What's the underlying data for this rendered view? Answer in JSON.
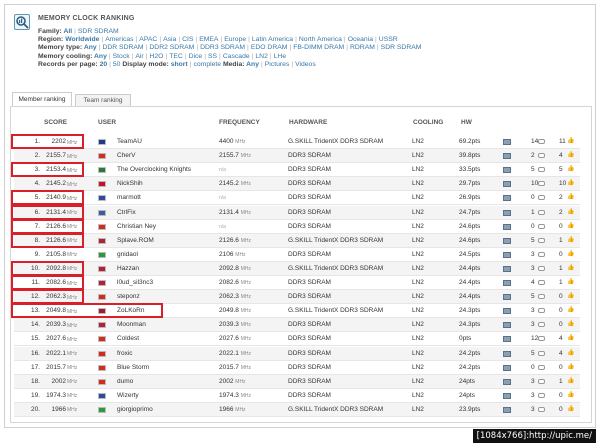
{
  "page_title": "MEMORY CLOCK RANKING",
  "filters": [
    {
      "label": "Family:",
      "options": [
        "All",
        "SDR SDRAM"
      ],
      "selected": "All"
    },
    {
      "label": "Region:",
      "options": [
        "Worldwide",
        "Americas",
        "APAC",
        "Asia",
        "CIS",
        "EMEA",
        "Europe",
        "Latin America",
        "North America",
        "Oceania",
        "USSR"
      ],
      "selected": "Worldwide"
    },
    {
      "label": "Memory type:",
      "options": [
        "Any",
        "DDR SDRAM",
        "DDR2 SDRAM",
        "DDR3 SDRAM",
        "EDO DRAM",
        "FB-DIMM DRAM",
        "RDRAM",
        "SDR SDRAM"
      ],
      "selected": "Any"
    },
    {
      "label": "Memory cooling:",
      "options": [
        "Any",
        "Stock",
        "Air",
        "H2O",
        "TEC",
        "Dice",
        "SS",
        "Cascade",
        "LN2",
        "LHe"
      ],
      "selected": "Any"
    },
    {
      "label": "Records per page:",
      "options": [
        "20",
        "50"
      ],
      "selected": "20",
      "extra_label": "Display mode:",
      "extra_options": [
        "short",
        "complete"
      ],
      "extra_selected": "short",
      "extra2_label": "Media:",
      "extra2_options": [
        "Any",
        "Pictures",
        "Videos"
      ],
      "extra2_selected": "Any"
    }
  ],
  "tabs": [
    {
      "label": "Member ranking",
      "active": true
    },
    {
      "label": "Team ranking",
      "active": false
    }
  ],
  "columns": {
    "score": "SCORE",
    "user": "USER",
    "frequency": "FREQUENCY",
    "hardware": "HARDWARE",
    "cooling": "COOLING",
    "hw": "HW"
  },
  "mhz_unit": "MHz",
  "na_text": "n/a",
  "rows": [
    {
      "rank": "1.",
      "score": "2202",
      "user": "TeamAU",
      "flag": "#1a3b8c",
      "freq": "4400",
      "freq_unit": "MHz",
      "hardware": "G.SKILL TridentX DDR3 SDRAM",
      "cooling": "LN2",
      "pts": "69.2pts",
      "comments": "14",
      "likes": "11"
    },
    {
      "rank": "2.",
      "score": "2155.7",
      "user": "CherV",
      "flag": "#d52b1e",
      "freq": "2155.7",
      "freq_unit": "MHz",
      "hardware": "DDR3 SDRAM",
      "cooling": "LN2",
      "pts": "39.8pts",
      "comments": "2",
      "likes": "4"
    },
    {
      "rank": "3.",
      "score": "2153.4",
      "user": "The Overclocking Knights",
      "flag": "#2b7a3a",
      "freq": "",
      "freq_unit": "",
      "hardware": "DDR3 SDRAM",
      "cooling": "LN2",
      "pts": "33.5pts",
      "comments": "5",
      "likes": "5"
    },
    {
      "rank": "4.",
      "score": "2145.2",
      "user": "NickShih",
      "flag": "#c8102e",
      "freq": "2145.2",
      "freq_unit": "MHz",
      "hardware": "DDR3 SDRAM",
      "cooling": "LN2",
      "pts": "29.7pts",
      "comments": "10",
      "likes": "10"
    },
    {
      "rank": "5.",
      "score": "2140.9",
      "user": "marmott",
      "flag": "#2b4aa0",
      "freq": "",
      "freq_unit": "",
      "hardware": "DDR3 SDRAM",
      "cooling": "LN2",
      "pts": "26.9pts",
      "comments": "0",
      "likes": "2"
    },
    {
      "rank": "6.",
      "score": "2131.4",
      "user": "CtrlFix",
      "flag": "#3b5aa8",
      "freq": "2131.4",
      "freq_unit": "MHz",
      "hardware": "DDR3 SDRAM",
      "cooling": "LN2",
      "pts": "24.7pts",
      "comments": "1",
      "likes": "2"
    },
    {
      "rank": "7.",
      "score": "2126.6",
      "user": "Christian Ney",
      "flag": "#d52b1e",
      "freq": "",
      "freq_unit": "",
      "hardware": "DDR3 SDRAM",
      "cooling": "LN2",
      "pts": "24.6pts",
      "comments": "0",
      "likes": "0"
    },
    {
      "rank": "8.",
      "score": "2126.6",
      "user": "Splave.ROM",
      "flag": "#b22234",
      "freq": "2126.6",
      "freq_unit": "MHz",
      "hardware": "G.SKILL TridentX DDR3 SDRAM",
      "cooling": "LN2",
      "pts": "24.6pts",
      "comments": "5",
      "likes": "1"
    },
    {
      "rank": "9.",
      "score": "2105.8",
      "user": "gnidaol",
      "flag": "#2a9a3a",
      "freq": "2106",
      "freq_unit": "MHz",
      "hardware": "DDR3 SDRAM",
      "cooling": "LN2",
      "pts": "24.5pts",
      "comments": "3",
      "likes": "0"
    },
    {
      "rank": "10.",
      "score": "2092.8",
      "user": "Hazzan",
      "flag": "#b22234",
      "freq": "2092.8",
      "freq_unit": "MHz",
      "hardware": "G.SKILL TridentX DDR3 SDRAM",
      "cooling": "LN2",
      "pts": "24.4pts",
      "comments": "3",
      "likes": "1"
    },
    {
      "rank": "11.",
      "score": "2082.6",
      "user": "l0ud_sil3nc3",
      "flag": "#b22234",
      "freq": "2082.6",
      "freq_unit": "MHz",
      "hardware": "DDR3 SDRAM",
      "cooling": "LN2",
      "pts": "24.4pts",
      "comments": "4",
      "likes": "1"
    },
    {
      "rank": "12.",
      "score": "2062.3",
      "user": "steponz",
      "flag": "#d52b1e",
      "freq": "2062.3",
      "freq_unit": "MHz",
      "hardware": "DDR3 SDRAM",
      "cooling": "LN2",
      "pts": "24.4pts",
      "comments": "5",
      "likes": "0"
    },
    {
      "rank": "13.",
      "score": "2049.8",
      "user": "ZoLKoRn",
      "flag": "#a51931",
      "freq": "2049.8",
      "freq_unit": "MHz",
      "hardware": "G.SKILL TridentX DDR3 SDRAM",
      "cooling": "LN2",
      "pts": "24.3pts",
      "comments": "3",
      "likes": "0"
    },
    {
      "rank": "14.",
      "score": "2039.3",
      "user": "Moonman",
      "flag": "#b22234",
      "freq": "2039.3",
      "freq_unit": "MHz",
      "hardware": "DDR3 SDRAM",
      "cooling": "LN2",
      "pts": "24.3pts",
      "comments": "3",
      "likes": "0"
    },
    {
      "rank": "15.",
      "score": "2027.6",
      "user": "Coldest",
      "flag": "#d52b1e",
      "freq": "2027.6",
      "freq_unit": "MHz",
      "hardware": "DDR3 SDRAM",
      "cooling": "LN2",
      "pts": "0pts",
      "comments": "12",
      "likes": "4"
    },
    {
      "rank": "16.",
      "score": "2022.1",
      "user": "froxic",
      "flag": "#d52b1e",
      "freq": "2022.1",
      "freq_unit": "MHz",
      "hardware": "DDR3 SDRAM",
      "cooling": "LN2",
      "pts": "24.2pts",
      "comments": "5",
      "likes": "4"
    },
    {
      "rank": "17.",
      "score": "2015.7",
      "user": "Blue Storm",
      "flag": "#d52b1e",
      "freq": "2015.7",
      "freq_unit": "MHz",
      "hardware": "DDR3 SDRAM",
      "cooling": "LN2",
      "pts": "24.2pts",
      "comments": "0",
      "likes": "0"
    },
    {
      "rank": "18.",
      "score": "2002",
      "user": "dumo",
      "flag": "#d52b1e",
      "freq": "2002",
      "freq_unit": "MHz",
      "hardware": "DDR3 SDRAM",
      "cooling": "LN2",
      "pts": "24pts",
      "comments": "3",
      "likes": "1"
    },
    {
      "rank": "19.",
      "score": "1974.3",
      "user": "Wizerty",
      "flag": "#2b4aa0",
      "freq": "1974.3",
      "freq_unit": "MHz",
      "hardware": "DDR3 SDRAM",
      "cooling": "LN2",
      "pts": "24pts",
      "comments": "3",
      "likes": "0"
    },
    {
      "rank": "20.",
      "score": "1966",
      "user": "giorgioprimo",
      "flag": "#2a9a3a",
      "freq": "1966",
      "freq_unit": "MHz",
      "hardware": "G.SKILL TridentX DDR3 SDRAM",
      "cooling": "LN2",
      "pts": "23.9pts",
      "comments": "3",
      "likes": "0"
    }
  ],
  "highlighted_ranks": [
    "1.",
    "3.",
    "5.",
    "6.",
    "7.",
    "8.",
    "10.",
    "11.",
    "12.",
    "13."
  ],
  "highlight_color": "#d9202a",
  "link_color": "#3a78a8",
  "watermark": "[1084x766]:http://upic.me/"
}
